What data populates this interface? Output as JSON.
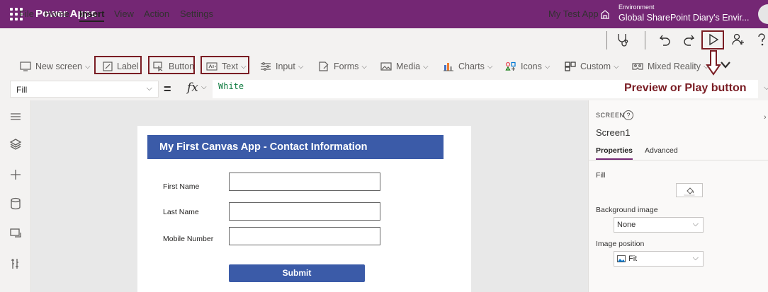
{
  "titlebar": {
    "app_name": "Power Apps",
    "env_label": "Environment",
    "env_value": "Global SharePoint Diary's Envir..."
  },
  "menu": {
    "items": [
      "File",
      "Home",
      "Insert",
      "View",
      "Action",
      "Settings"
    ],
    "active": "Insert",
    "app_title": "My Test App"
  },
  "ribbon": {
    "new_screen": "New screen",
    "label": "Label",
    "button": "Button",
    "text": "Text",
    "input": "Input",
    "forms": "Forms",
    "media": "Media",
    "charts": "Charts",
    "icons": "Icons",
    "custom": "Custom",
    "mixed_reality": "Mixed Reality"
  },
  "formula": {
    "property": "Fill",
    "equals": "=",
    "fx": "fx",
    "value": "White"
  },
  "annotation": "Preview  or Play button",
  "canvas": {
    "header_title": "My First Canvas App - Contact Information",
    "fields": [
      {
        "label": "First Name",
        "value": ""
      },
      {
        "label": "Last Name",
        "value": ""
      },
      {
        "label": "Mobile Number",
        "value": ""
      }
    ],
    "submit_label": "Submit"
  },
  "properties_panel": {
    "kind": "SCREEN",
    "help": "?",
    "name": "Screen1",
    "tabs": [
      "Properties",
      "Advanced"
    ],
    "active_tab": "Properties",
    "fill_label": "Fill",
    "fill_value": "White",
    "background_image_label": "Background image",
    "background_image_value": "None",
    "image_position_label": "Image position",
    "image_position_value": "Fit"
  },
  "colors": {
    "brand": "#742774",
    "highlight_border": "#7a1d24",
    "header_blue": "#3b5ba8"
  }
}
